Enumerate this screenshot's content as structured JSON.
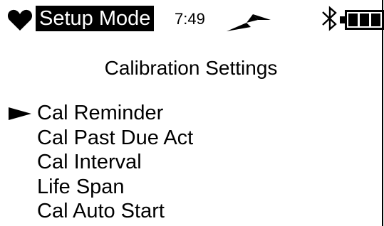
{
  "status_bar": {
    "mode": "Setup Mode",
    "time": "7:49",
    "icons": [
      "heart-icon",
      "signal-icon",
      "bluetooth-icon",
      "battery-icon"
    ],
    "battery_level": 1.0
  },
  "screen_title": "Calibration Settings",
  "menu": {
    "selected_index": 0,
    "items": [
      {
        "label": "Cal Reminder"
      },
      {
        "label": "Cal Past Due Act"
      },
      {
        "label": "Cal Interval"
      },
      {
        "label": "Life Span"
      },
      {
        "label": "Cal Auto Start"
      }
    ]
  },
  "colors": {
    "background": "#ffffff",
    "foreground": "#000000"
  }
}
